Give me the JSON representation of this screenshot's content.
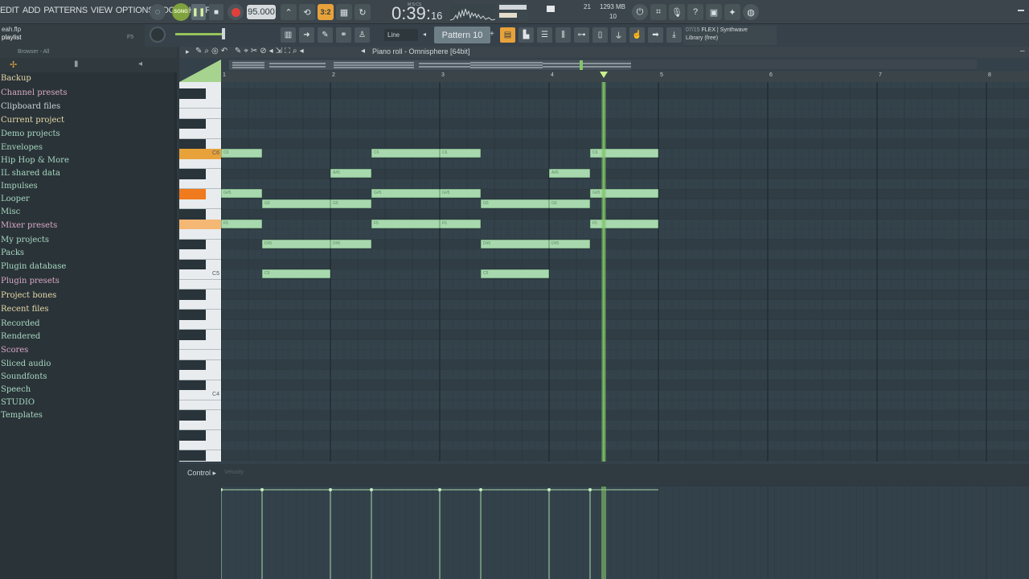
{
  "menu": [
    "EDIT",
    "ADD",
    "PATTERNS",
    "VIEW",
    "OPTIONS",
    "TOOLS",
    "HELP"
  ],
  "transport": {
    "song_label": "SONG",
    "tempo": "95.000",
    "time_label": "M:S:CS",
    "time_main": "0:39:",
    "time_sub": "16",
    "counter": "3:2"
  },
  "monitor": {
    "polyphony": "21",
    "ram": "1293 MB",
    "ram_sub": "10"
  },
  "hint": {
    "file": "eah.flp",
    "sub": "playlist",
    "note": "F5"
  },
  "snap": "Line",
  "pattern": "Pattern 10",
  "news": {
    "line1_dim": "07/15",
    "line1": "FLEX | Synthwave",
    "line2": "Library (free)"
  },
  "browser": {
    "header": "Browser - All",
    "items": [
      {
        "label": "Backup",
        "color": "#e7d9a8"
      },
      {
        "label": "Channel presets",
        "color": "#d9a8c7"
      },
      {
        "label": "Clipboard files",
        "color": "#c9d3d6"
      },
      {
        "label": "Current project",
        "color": "#e7d9a8"
      },
      {
        "label": "Demo projects",
        "color": "#a8d8c0"
      },
      {
        "label": "Envelopes",
        "color": "#a8d8c0"
      },
      {
        "label": "Hip Hop & More",
        "color": "#a8d8c0"
      },
      {
        "label": "IL shared data",
        "color": "#a8d8c0"
      },
      {
        "label": "Impulses",
        "color": "#a8d8c0"
      },
      {
        "label": "Looper",
        "color": "#a8d8c0"
      },
      {
        "label": "Misc",
        "color": "#a8d8c0"
      },
      {
        "label": "Mixer presets",
        "color": "#d9a8c7"
      },
      {
        "label": "My projects",
        "color": "#a8d8c0"
      },
      {
        "label": "Packs",
        "color": "#a8d8c0"
      },
      {
        "label": "Plugin database",
        "color": "#a8d8c0"
      },
      {
        "label": "Plugin presets",
        "color": "#d9a8c7"
      },
      {
        "label": "Project bones",
        "color": "#e7d9a8"
      },
      {
        "label": "Recent files",
        "color": "#e7d9a8"
      },
      {
        "label": "Recorded",
        "color": "#a8d8c0"
      },
      {
        "label": "Rendered",
        "color": "#a8d8c0"
      },
      {
        "label": "Scores",
        "color": "#d9a8c7"
      },
      {
        "label": "Sliced audio",
        "color": "#a8d8c0"
      },
      {
        "label": "Soundfonts",
        "color": "#a8d8c0"
      },
      {
        "label": "Speech",
        "color": "#a8d8c0"
      },
      {
        "label": "STUDIO",
        "color": "#a8d8c0"
      },
      {
        "label": "Templates",
        "color": "#a8d8c0"
      }
    ]
  },
  "piano_roll": {
    "title": "Piano roll - Omnisphere [64bit]",
    "bars": [
      "1",
      "2",
      "3",
      "4",
      "5",
      "6",
      "7",
      "8"
    ],
    "key_labels": [
      "C6",
      "C5",
      "C4"
    ],
    "control_label": "Control",
    "control_sub": "Velocity",
    "notes": [
      {
        "pitch": "C6",
        "start": 1.0,
        "length": 0.375
      },
      {
        "pitch": "G#5",
        "start": 1.0,
        "length": 0.375
      },
      {
        "pitch": "F5",
        "start": 1.0,
        "length": 0.375
      },
      {
        "pitch": "D#5",
        "start": 1.375,
        "length": 0.625
      },
      {
        "pitch": "G5",
        "start": 1.375,
        "length": 0.625
      },
      {
        "pitch": "C5",
        "start": 1.375,
        "length": 0.625
      },
      {
        "pitch": "A#5",
        "start": 2.0,
        "length": 0.375
      },
      {
        "pitch": "G5",
        "start": 2.0,
        "length": 0.375
      },
      {
        "pitch": "D#5",
        "start": 2.0,
        "length": 0.375
      },
      {
        "pitch": "C6",
        "start": 2.375,
        "length": 0.625
      },
      {
        "pitch": "G#5",
        "start": 2.375,
        "length": 0.625
      },
      {
        "pitch": "F5",
        "start": 2.375,
        "length": 0.625
      },
      {
        "pitch": "C6",
        "start": 3.0,
        "length": 0.375
      },
      {
        "pitch": "G#5",
        "start": 3.0,
        "length": 0.375
      },
      {
        "pitch": "F5",
        "start": 3.0,
        "length": 0.375
      },
      {
        "pitch": "D#5",
        "start": 3.375,
        "length": 0.625
      },
      {
        "pitch": "G5",
        "start": 3.375,
        "length": 0.625
      },
      {
        "pitch": "C5",
        "start": 3.375,
        "length": 0.625
      },
      {
        "pitch": "A#5",
        "start": 4.0,
        "length": 0.375
      },
      {
        "pitch": "G5",
        "start": 4.0,
        "length": 0.375
      },
      {
        "pitch": "D#5",
        "start": 4.0,
        "length": 0.375
      },
      {
        "pitch": "C6",
        "start": 4.375,
        "length": 0.625
      },
      {
        "pitch": "G#5",
        "start": 4.375,
        "length": 0.625
      },
      {
        "pitch": "F5",
        "start": 4.375,
        "length": 0.625
      }
    ],
    "playhead_bar": 4.5
  },
  "colors": {
    "note_fill": "#a8d8ad",
    "accent_orange": "#e8a23a",
    "playhead": "#84c56a"
  }
}
